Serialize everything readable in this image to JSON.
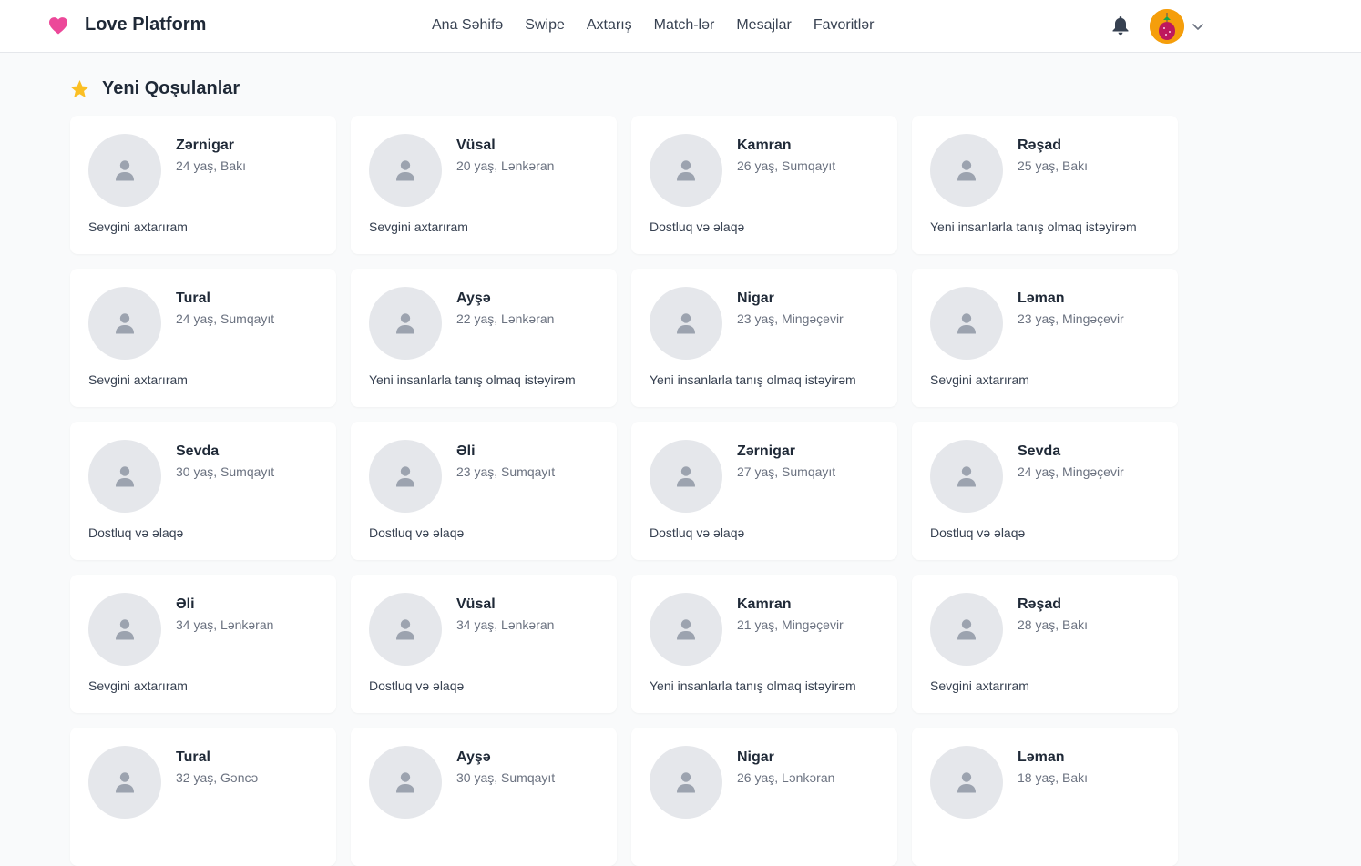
{
  "brand": {
    "name": "Love Platform",
    "icon": "heart-icon",
    "color": "#ec4899"
  },
  "nav": [
    {
      "label": "Ana Səhifə"
    },
    {
      "label": "Swipe"
    },
    {
      "label": "Axtarış"
    },
    {
      "label": "Match-lər"
    },
    {
      "label": "Mesajlar"
    },
    {
      "label": "Favoritlər"
    }
  ],
  "header": {
    "notification_icon": "bell-icon",
    "avatar_icon": "user-avatar",
    "menu_icon": "chevron-down-icon"
  },
  "section": {
    "title": "Yeni Qoşulanlar",
    "icon": "star-icon",
    "icon_color": "#fbbf24"
  },
  "profiles": [
    {
      "name": "Zərnigar",
      "meta": "24 yaş, Bakı",
      "bio": "Sevgini axtarıram"
    },
    {
      "name": "Vüsal",
      "meta": "20 yaş, Lənkəran",
      "bio": "Sevgini axtarıram"
    },
    {
      "name": "Kamran",
      "meta": "26 yaş, Sumqayıt",
      "bio": "Dostluq və əlaqə"
    },
    {
      "name": "Rəşad",
      "meta": "25 yaş, Bakı",
      "bio": "Yeni insanlarla tanış olmaq istəyirəm"
    },
    {
      "name": "Tural",
      "meta": "24 yaş, Sumqayıt",
      "bio": "Sevgini axtarıram"
    },
    {
      "name": "Ayşə",
      "meta": "22 yaş, Lənkəran",
      "bio": "Yeni insanlarla tanış olmaq istəyirəm"
    },
    {
      "name": "Nigar",
      "meta": "23 yaş, Mingəçevir",
      "bio": "Yeni insanlarla tanış olmaq istəyirəm"
    },
    {
      "name": "Ləman",
      "meta": "23 yaş, Mingəçevir",
      "bio": "Sevgini axtarıram"
    },
    {
      "name": "Sevda",
      "meta": "30 yaş, Sumqayıt",
      "bio": "Dostluq və əlaqə"
    },
    {
      "name": "Əli",
      "meta": "23 yaş, Sumqayıt",
      "bio": "Dostluq və əlaqə"
    },
    {
      "name": "Zərnigar",
      "meta": "27 yaş, Sumqayıt",
      "bio": "Dostluq və əlaqə"
    },
    {
      "name": "Sevda",
      "meta": "24 yaş, Mingəçevir",
      "bio": "Dostluq və əlaqə"
    },
    {
      "name": "Əli",
      "meta": "34 yaş, Lənkəran",
      "bio": "Sevgini axtarıram"
    },
    {
      "name": "Vüsal",
      "meta": "34 yaş, Lənkəran",
      "bio": "Dostluq və əlaqə"
    },
    {
      "name": "Kamran",
      "meta": "21 yaş, Mingəçevir",
      "bio": "Yeni insanlarla tanış olmaq istəyirəm"
    },
    {
      "name": "Rəşad",
      "meta": "28 yaş, Bakı",
      "bio": "Sevgini axtarıram"
    },
    {
      "name": "Tural",
      "meta": "32 yaş, Gəncə",
      "bio": ""
    },
    {
      "name": "Ayşə",
      "meta": "30 yaş, Sumqayıt",
      "bio": ""
    },
    {
      "name": "Nigar",
      "meta": "26 yaş, Lənkəran",
      "bio": ""
    },
    {
      "name": "Ləman",
      "meta": "18 yaş, Bakı",
      "bio": ""
    }
  ]
}
